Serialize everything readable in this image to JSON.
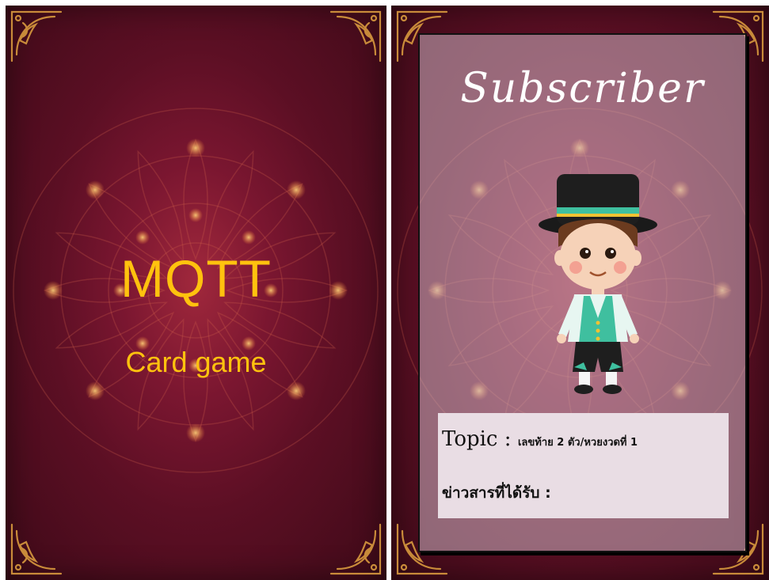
{
  "back_card": {
    "title": "MQTT",
    "subtitle": "Card game"
  },
  "front_card": {
    "role": "Subscriber",
    "topic_label": "Topic :",
    "topic_value": "เลขท้าย 2 ตัว/หวยงวดที่ 1",
    "received_label": "ข่าวสารที่ได้รับ :",
    "character_icon": "boy-in-top-hat-icon"
  },
  "colors": {
    "card_background": "#5c0f24",
    "title_gold": "#ffc20e",
    "ornament_gold": "#c98b3a",
    "panel_overlay": "#cdb4c3",
    "info_box": "#e9dde4"
  }
}
